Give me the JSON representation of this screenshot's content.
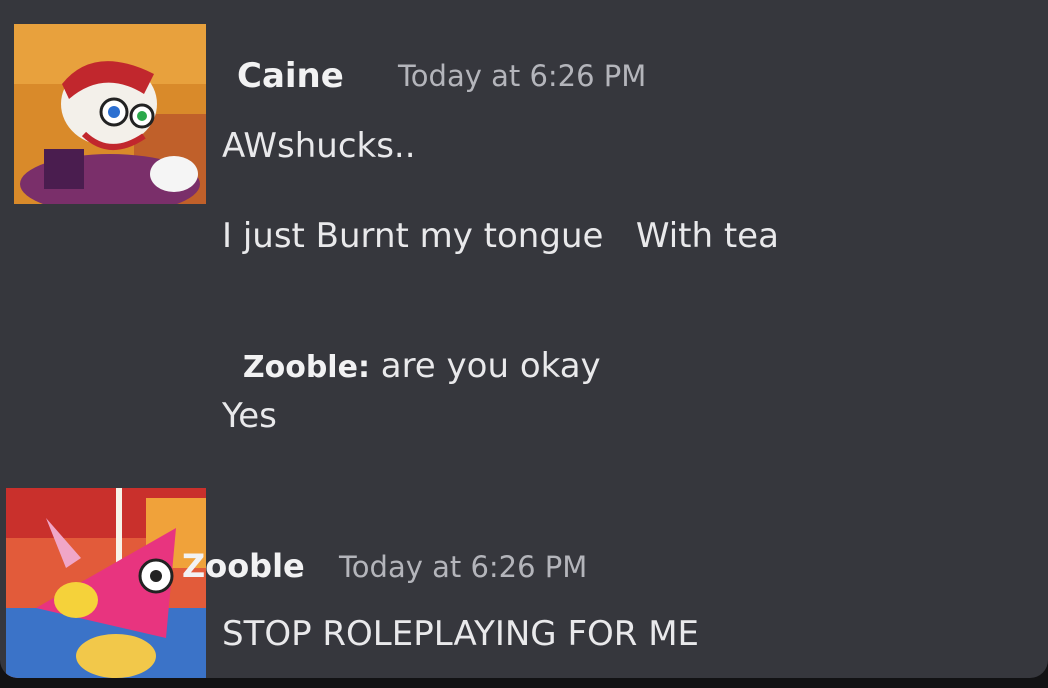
{
  "messages": [
    {
      "author": "Caine",
      "timestamp": "Today at 6:26 PM",
      "avatar_icon": "caine-avatar",
      "lines": [
        "AWshucks..",
        "I just Burnt my tongue   With tea",
        {
          "prefix": "Zooble:",
          "text": " are you okay"
        },
        "Yes"
      ]
    },
    {
      "author": "Zooble",
      "timestamp": "Today at 6:26 PM",
      "avatar_icon": "zooble-avatar",
      "lines": [
        "STOP ROLEPLAYING FOR ME"
      ]
    }
  ],
  "colors": {
    "background": "#36373d",
    "username": "#f2f2f3",
    "timestamp": "#b4b5bb",
    "text": "#e9e9eb"
  }
}
